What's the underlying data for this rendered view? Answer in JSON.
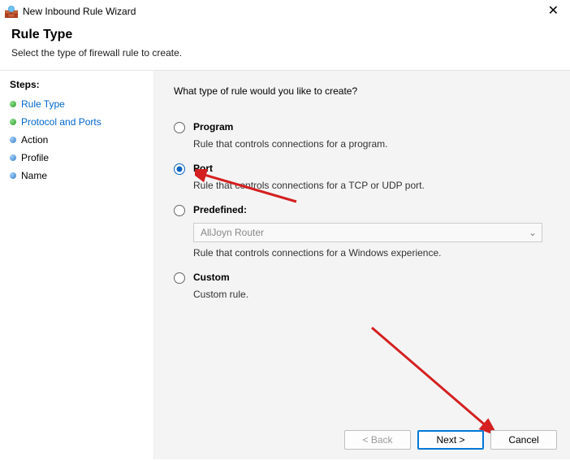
{
  "window": {
    "title": "New Inbound Rule Wizard",
    "close_glyph": "✕"
  },
  "header": {
    "title": "Rule Type",
    "subtitle": "Select the type of firewall rule to create."
  },
  "sidebar": {
    "steps_label": "Steps:",
    "items": [
      {
        "label": "Rule Type"
      },
      {
        "label": "Protocol and Ports"
      },
      {
        "label": "Action"
      },
      {
        "label": "Profile"
      },
      {
        "label": "Name"
      }
    ]
  },
  "main": {
    "prompt": "What type of rule would you like to create?",
    "options": {
      "program": {
        "label": "Program",
        "description": "Rule that controls connections for a program."
      },
      "port": {
        "label": "Port",
        "description": "Rule that controls connections for a TCP or UDP port."
      },
      "predefined": {
        "label": "Predefined:",
        "description": "Rule that controls connections for a Windows experience.",
        "selected_value": "AllJoyn Router"
      },
      "custom": {
        "label": "Custom",
        "description": "Custom rule."
      }
    },
    "selected": "port"
  },
  "buttons": {
    "back": "< Back",
    "next": "Next >",
    "cancel": "Cancel"
  },
  "annotation": {
    "color": "#d42020"
  }
}
